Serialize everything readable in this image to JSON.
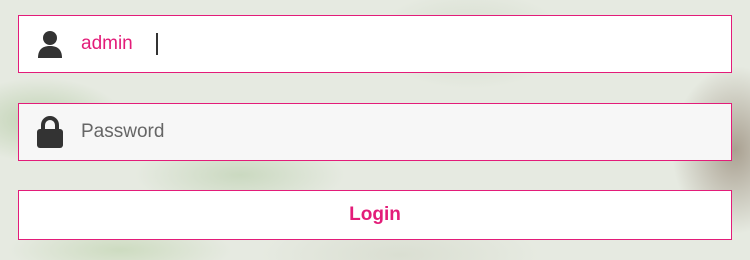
{
  "login": {
    "username": {
      "value": "admin",
      "icon": "user-icon"
    },
    "password": {
      "placeholder": "Password",
      "icon": "lock-icon"
    },
    "submit_label": "Login"
  },
  "colors": {
    "accent": "#e31c79",
    "icon": "#333333"
  }
}
